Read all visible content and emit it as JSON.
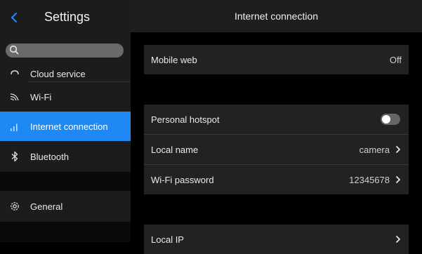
{
  "colors": {
    "accent": "#1e88f5",
    "background": "#000000",
    "sidebar": "#1c1c1c",
    "card": "#222222"
  },
  "sidebar": {
    "title": "Settings",
    "back_icon": "chevron-left-icon",
    "search": {
      "icon": "search-icon",
      "value": ""
    },
    "items": [
      {
        "id": "cloud-service",
        "label": "Cloud service",
        "icon": "cloud-icon"
      },
      {
        "id": "wifi",
        "label": "Wi-Fi",
        "icon": "wifi-icon"
      },
      {
        "id": "internet-connection",
        "label": "Internet connection",
        "icon": "signal-bars-icon",
        "active": true
      },
      {
        "id": "bluetooth",
        "label": "Bluetooth",
        "icon": "bluetooth-icon"
      },
      {
        "id": "general",
        "label": "General",
        "icon": "gear-icon"
      }
    ]
  },
  "main": {
    "title": "Internet connection",
    "mobile_web": {
      "label": "Mobile web",
      "value": "Off"
    },
    "hotspot_group": {
      "personal_hotspot": {
        "label": "Personal hotspot",
        "toggle_on": false
      },
      "local_name": {
        "label": "Local name",
        "value": "camera"
      },
      "wifi_password": {
        "label": "Wi-Fi password",
        "value": "12345678"
      }
    },
    "local_ip": {
      "label": "Local IP"
    }
  }
}
